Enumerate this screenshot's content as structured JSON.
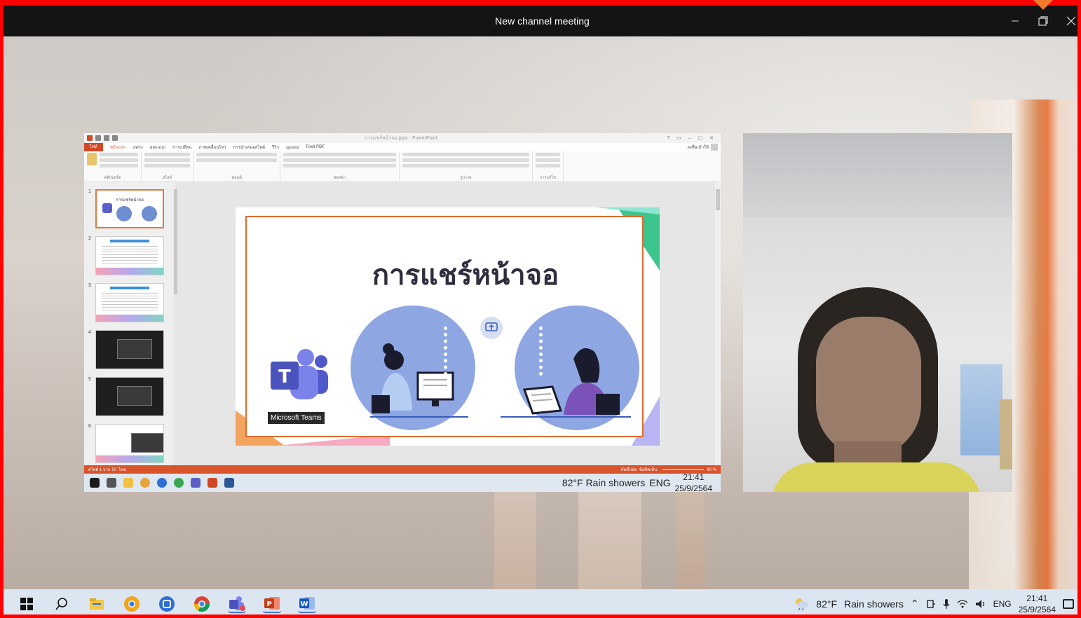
{
  "window": {
    "title": "New channel meeting",
    "minimize_glyph": "—",
    "maximize_glyph": "❐",
    "close_glyph": "✕"
  },
  "shared_screen": {
    "file_name": "การแชร์หน้าจอ.pptx - PowerPoint",
    "tabs": [
      "ไฟล์",
      "หน้าแรก",
      "แทรก",
      "ออกแบบ",
      "การเปลี่ยน",
      "ภาพเคลื่อนไหว",
      "การนำเสนอสไลด์",
      "รีวิว",
      "มุมมอง",
      "Foxit PDF"
    ],
    "sign_in_label": "ลงชื่อเข้าใช้",
    "ribbon_groups": [
      "คลิปบอร์ด",
      "สไลด์",
      "ฟอนต์",
      "ย่อหน้า",
      "รูปวาด",
      "การแก้ไข"
    ],
    "thumb_numbers": [
      "1",
      "2",
      "3",
      "4",
      "5",
      "6"
    ],
    "thumb1_title": "การแชร์หน้าจอ",
    "slide": {
      "headline": "การแชร์หน้าจอ",
      "teams_label": "Microsoft Teams",
      "teams_letter": "T"
    },
    "status": {
      "slide_count": "สไลด์ 1 จาก 10",
      "language": "ไทย",
      "notes": "บันทึกย่อ",
      "comments": "ข้อคิดเห็น",
      "zoom": "80 %"
    },
    "taskbar": {
      "weather": "82°F  Rain showers",
      "lang": "ENG",
      "time": "21:41",
      "date": "25/9/2564"
    }
  },
  "taskbar": {
    "weather_temp": "82°F",
    "weather_text": "Rain showers",
    "lang": "ENG",
    "time": "21:41",
    "date": "25/9/2564",
    "apps": [
      {
        "name": "start-button",
        "icon": "windows-icon"
      },
      {
        "name": "search-button",
        "icon": "search-icon"
      },
      {
        "name": "file-explorer-app",
        "icon": "folder-icon"
      },
      {
        "name": "chrome-app-1",
        "icon": "chrome-icon"
      },
      {
        "name": "edge-app",
        "icon": "edge-icon"
      },
      {
        "name": "chrome-app-2",
        "icon": "chrome-icon"
      },
      {
        "name": "teams-app",
        "icon": "teams-icon"
      },
      {
        "name": "powerpoint-app",
        "icon": "powerpoint-icon"
      },
      {
        "name": "word-app",
        "icon": "word-icon"
      }
    ]
  },
  "colors": {
    "frame": "#ff0000",
    "titlebar": "#141414",
    "powerpoint_accent": "#d24726",
    "teams_purple": "#5b5fc7",
    "slide_circle": "#8ea7e3"
  }
}
